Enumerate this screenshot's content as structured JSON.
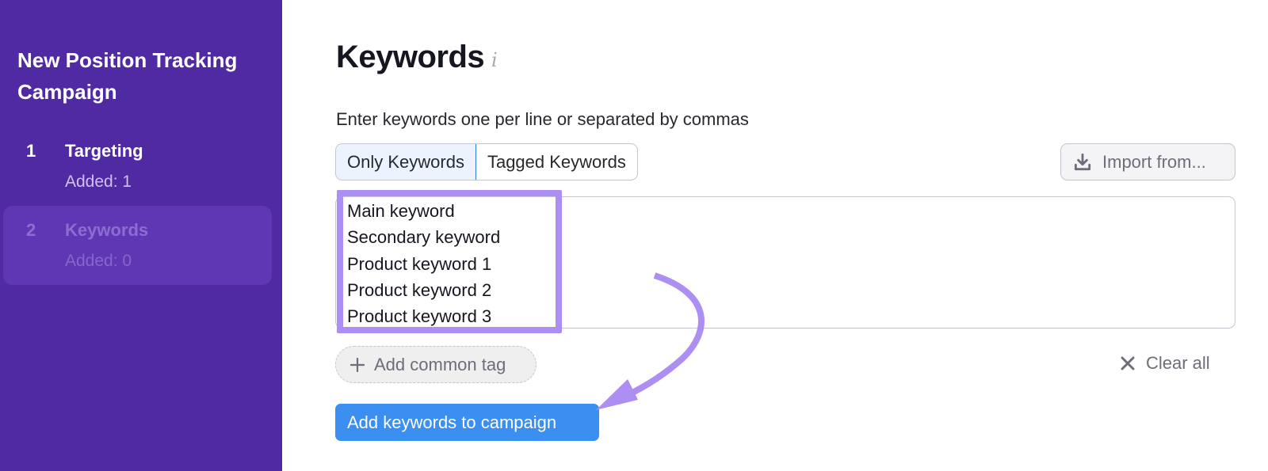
{
  "sidebar": {
    "title": "New Position Tracking Campaign",
    "steps": [
      {
        "number": "1",
        "label": "Targeting",
        "sub": "Added: 1",
        "state": "done"
      },
      {
        "number": "2",
        "label": "Keywords",
        "sub": "Added: 0",
        "state": "current"
      }
    ]
  },
  "main": {
    "title": "Keywords",
    "info_icon": "i",
    "hint": "Enter keywords one per line or separated by commas",
    "tabs": [
      {
        "label": "Only Keywords",
        "selected": true
      },
      {
        "label": "Tagged Keywords",
        "selected": false
      }
    ],
    "import_button": {
      "label": "Import from...",
      "icon": "download-icon"
    },
    "keywords": [
      "Main keyword",
      "Secondary keyword",
      "Product keyword 1",
      "Product keyword 2",
      "Product keyword 3"
    ],
    "add_tag_button": {
      "label": "Add common tag",
      "icon": "plus-icon"
    },
    "clear_button": {
      "label": "Clear all",
      "icon": "close-icon"
    },
    "submit_button": {
      "label": "Add keywords to campaign"
    }
  },
  "annotation": {
    "highlight_color": "#ad8ef2",
    "arrow_color": "#ad8ef2"
  },
  "colors": {
    "sidebar_bg": "#4f2aa3",
    "primary": "#3b8ff0",
    "selected_tab_border": "#2d7de0"
  }
}
